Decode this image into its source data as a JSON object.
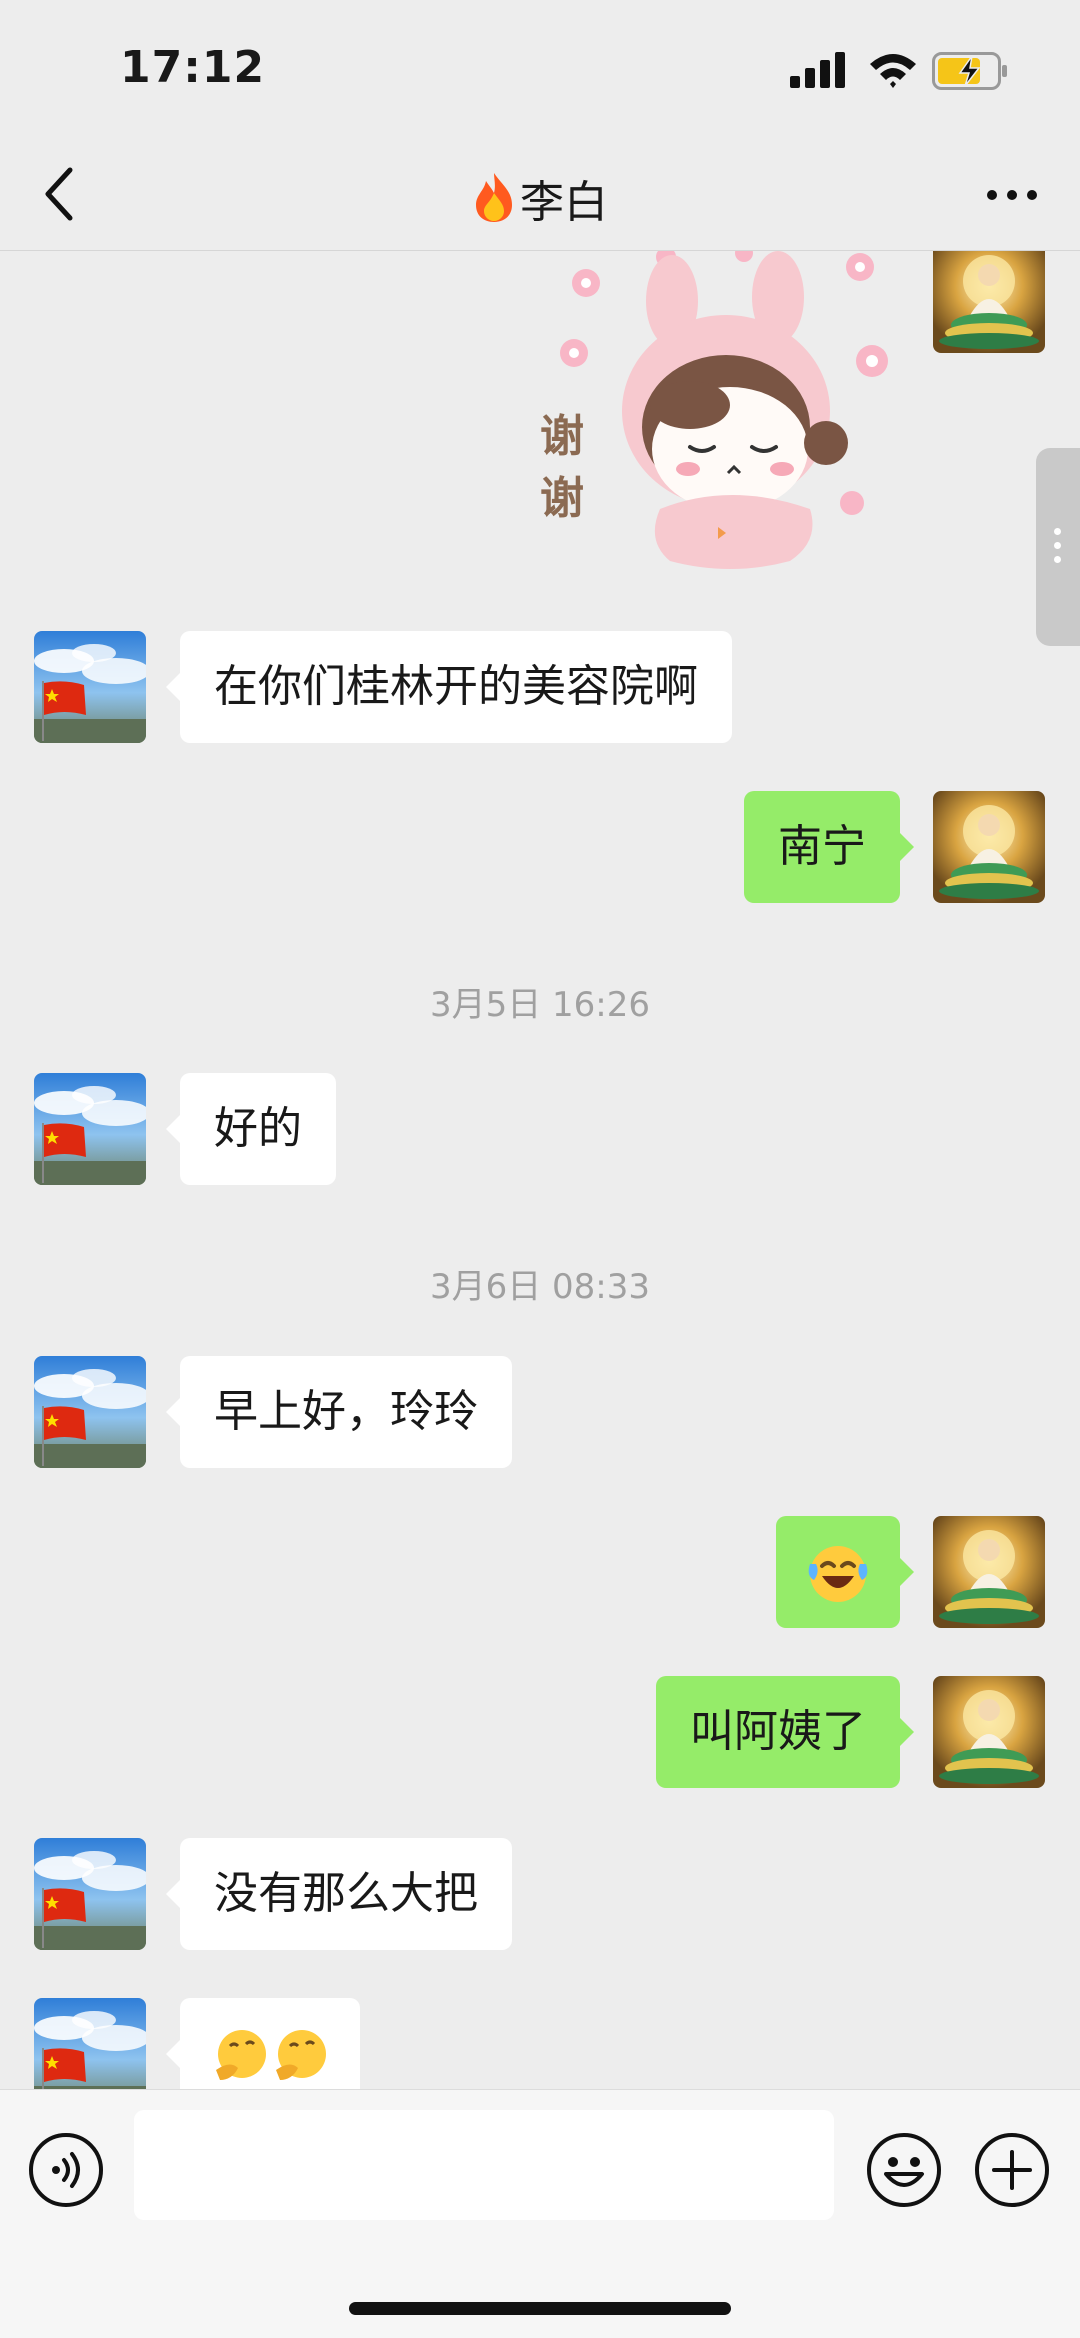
{
  "status_bar": {
    "time": "17:12",
    "battery_state": "charging",
    "icons": [
      "signal-icon",
      "wifi-icon",
      "battery-icon"
    ]
  },
  "nav": {
    "back_icon": "chevron-left-icon",
    "title_emoji": "fire-icon",
    "title": "李白",
    "more_icon": "more-dots-icon"
  },
  "messages": [
    {
      "from": "me",
      "kind": "sticker",
      "sticker_text": "谢谢",
      "description_icon": "bunny-girl-sticker"
    },
    {
      "from": "other",
      "kind": "text",
      "text": "在你们桂林开的美容院啊"
    },
    {
      "from": "me",
      "kind": "text",
      "text": "南宁"
    },
    {
      "kind": "time",
      "text": "3月5日 16:26"
    },
    {
      "from": "other",
      "kind": "text",
      "text": "好的"
    },
    {
      "kind": "time",
      "text": "3月6日 08:33"
    },
    {
      "from": "other",
      "kind": "text",
      "text": "早上好，玲玲"
    },
    {
      "from": "me",
      "kind": "emoji",
      "emoji": "laughing-crying-face"
    },
    {
      "from": "me",
      "kind": "text",
      "text": "叫阿姨了"
    },
    {
      "from": "other",
      "kind": "text",
      "text": "没有那么大把"
    },
    {
      "from": "other",
      "kind": "emoji",
      "emoji": "thinking-face x2"
    }
  ],
  "input_bar": {
    "voice_icon": "voice-icon",
    "placeholder": "",
    "emoji_icon": "smile-icon",
    "plus_icon": "plus-icon"
  },
  "colors": {
    "background": "#ededed",
    "my_bubble": "#95ec69",
    "their_bubble": "#ffffff",
    "timestamp": "#a0a0a0"
  }
}
